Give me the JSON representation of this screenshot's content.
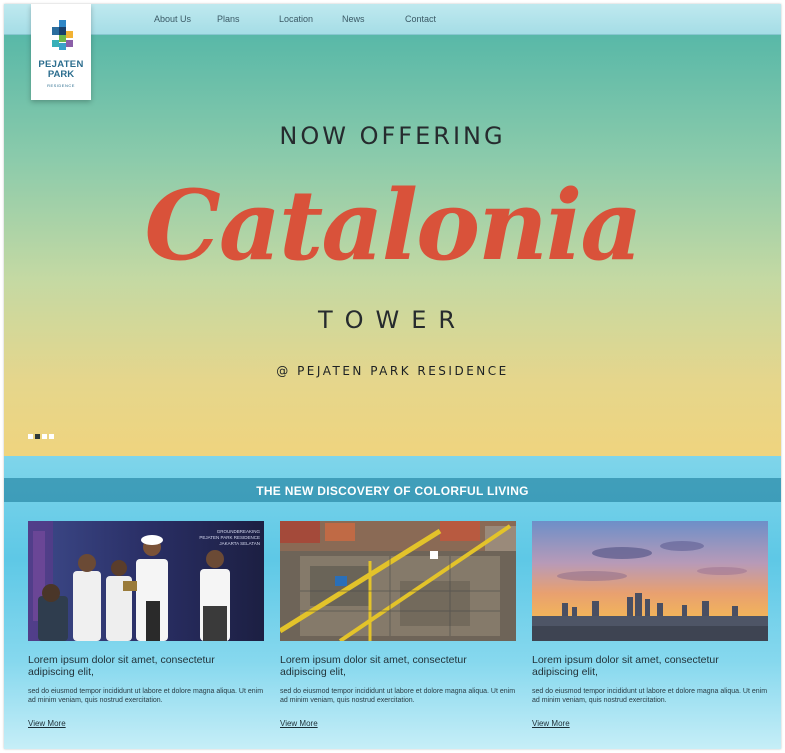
{
  "nav": {
    "items": [
      {
        "label": "About Us"
      },
      {
        "label": "Plans"
      },
      {
        "label": "Location"
      },
      {
        "label": "News"
      },
      {
        "label": "Contact"
      }
    ]
  },
  "logo": {
    "line1": "PEJATEN",
    "line2": "PARK",
    "line3": "RESIDENCE"
  },
  "hero": {
    "pre_title": "NOW OFFERING",
    "script_title": "Catalonia",
    "tower": "TOWER",
    "subtitle": "@ PEJATEN PARK RESIDENCE",
    "slides": 4,
    "active_slide": 2,
    "script_color": "#d9523a"
  },
  "section": {
    "banner": "THE NEW DISCOVERY OF COLORFUL LIVING",
    "photo_caption": "GROUNDBREAKING PEJATEN PARK RESIDENCE JAKARTA SELATAN",
    "cards": [
      {
        "title": "Lorem ipsum dolor sit amet, consectetur adipiscing elit,",
        "body": "sed do eiusmod tempor incididunt ut labore et dolore magna aliqua. Ut enim ad minim veniam, quis nostrud exercitation.",
        "link": "View More",
        "image": "groundbreaking-ceremony-photo"
      },
      {
        "title": "Lorem ipsum dolor sit amet, consectetur adipiscing elit,",
        "body": "sed do eiusmod tempor incididunt ut labore et dolore magna aliqua. Ut enim ad minim veniam, quis nostrud exercitation.",
        "link": "View More",
        "image": "construction-site-aerial-photo"
      },
      {
        "title": "Lorem ipsum dolor sit amet, consectetur adipiscing elit,",
        "body": "sed do eiusmod tempor incididunt ut labore et dolore magna aliqua. Ut enim ad minim veniam, quis nostrud exercitation.",
        "link": "View More",
        "image": "city-skyline-sunset-photo"
      }
    ]
  }
}
